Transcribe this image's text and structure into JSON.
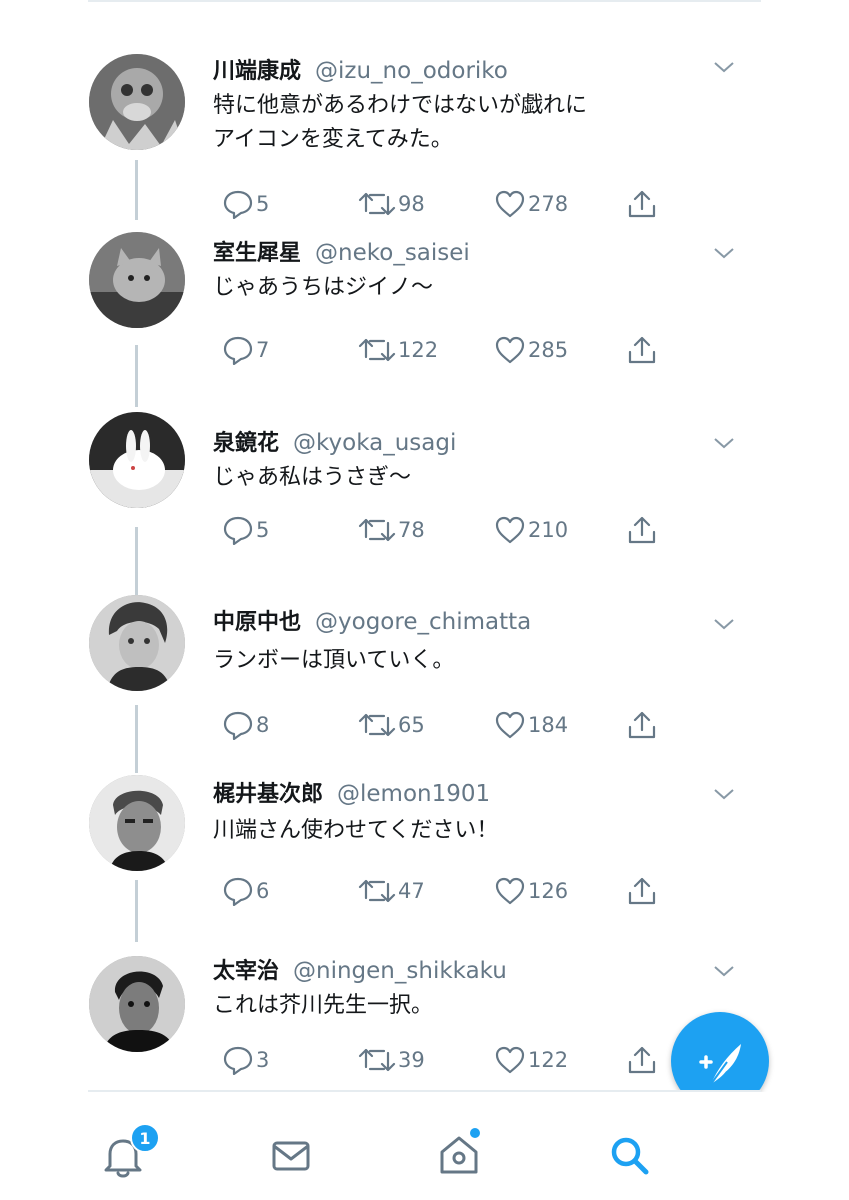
{
  "tweets": [
    {
      "name": "川端康成",
      "handle": "@izu_no_odoriko",
      "lines": [
        "特に他意があるわけではないが戯れに",
        "アイコンを変えてみた。"
      ],
      "replies": "5",
      "retweets": "98",
      "likes": "278"
    },
    {
      "name": "室生犀星",
      "handle": "@neko_saisei",
      "lines": [
        "じゃあうちはジイノ〜"
      ],
      "replies": "7",
      "retweets": "122",
      "likes": "285"
    },
    {
      "name": "泉鏡花",
      "handle": "@kyoka_usagi",
      "lines": [
        "じゃあ私はうさぎ〜"
      ],
      "replies": "5",
      "retweets": "78",
      "likes": "210"
    },
    {
      "name": "中原中也",
      "handle": "@yogore_chimatta",
      "lines": [
        "ランボーは頂いていく。"
      ],
      "replies": "8",
      "retweets": "65",
      "likes": "184"
    },
    {
      "name": "梶井基次郎",
      "handle": "@lemon1901",
      "lines": [
        "川端さん使わせてください！"
      ],
      "replies": "6",
      "retweets": "47",
      "likes": "126"
    },
    {
      "name": "太宰治",
      "handle": "@ningen_shikkaku",
      "lines": [
        "これは芥川先生一択。"
      ],
      "replies": "3",
      "retweets": "39",
      "likes": "122"
    }
  ],
  "nav": {
    "notifications_badge": "1",
    "items": [
      "bell-icon",
      "mail-icon",
      "home-icon",
      "search-icon"
    ],
    "active": "search-icon"
  },
  "compose_icon": "compose-feather-icon",
  "colors": {
    "accent": "#1da1f2",
    "text": "#14171a",
    "muted": "#657786",
    "thread": "#c4cfd6"
  }
}
